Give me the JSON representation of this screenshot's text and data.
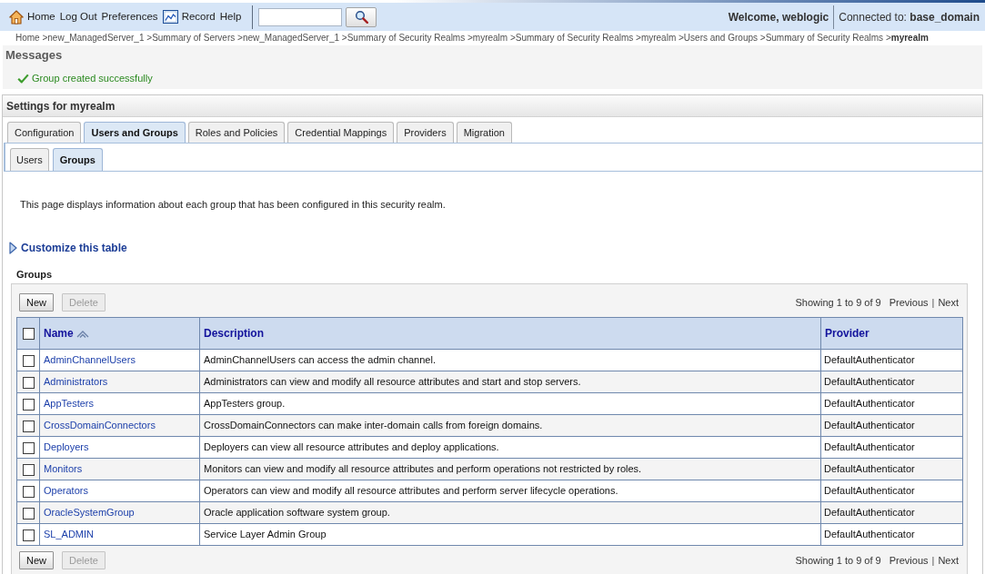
{
  "header": {
    "nav": [
      {
        "kind": "home",
        "label": "Home"
      },
      {
        "kind": "plain",
        "label": "Log Out"
      },
      {
        "kind": "plain",
        "label": "Preferences"
      },
      {
        "kind": "record",
        "label": "Record"
      },
      {
        "kind": "plain",
        "label": "Help"
      }
    ],
    "welcome": "Welcome, weblogic",
    "connection": "Connected to: **base_domain**"
  },
  "breadcrumb": {
    "separator": ">",
    "items": [
      {
        "label": "Home",
        "current": false
      },
      {
        "label": "new_ManagedServer_1",
        "current": false
      },
      {
        "label": "Summary of Servers",
        "current": false
      },
      {
        "label": "new_ManagedServer_1",
        "current": false
      },
      {
        "label": "Summary of Security Realms",
        "current": false
      },
      {
        "label": "myrealm",
        "current": false
      },
      {
        "label": "Summary of Security Realms",
        "current": false
      },
      {
        "label": "myrealm",
        "current": false
      },
      {
        "label": "Users and Groups",
        "current": false
      },
      {
        "label": "Summary of Security Realms",
        "current": false
      },
      {
        "label": "myrealm",
        "current": true
      }
    ]
  },
  "messages": {
    "title": "Messages",
    "items": [
      {
        "kind": "success",
        "text": "Group created successfully"
      }
    ]
  },
  "settings": {
    "title": "Settings for myrealm",
    "tabs": [
      {
        "label": "Configuration",
        "selected": false
      },
      {
        "label": "Users and Groups",
        "selected": true
      },
      {
        "label": "Roles and Policies",
        "selected": false
      },
      {
        "label": "Credential Mappings",
        "selected": false
      },
      {
        "label": "Providers",
        "selected": false
      },
      {
        "label": "Migration",
        "selected": false
      }
    ],
    "subtabs": [
      {
        "label": "Users",
        "selected": false
      },
      {
        "label": "Groups",
        "selected": true
      }
    ],
    "intro": "This page displays information about each group that has been configured in this security realm.",
    "customize": {
      "label": "Customize this table",
      "expanded": false
    },
    "groups": {
      "title": "Groups",
      "top_toolbar": {
        "buttons": [
          {
            "label": "New",
            "disabled": false
          },
          {
            "label": "Delete",
            "disabled": true
          }
        ],
        "pagination": {
          "summary": "Showing 1 to 9 of 9",
          "previous": {
            "label": "Previous",
            "disabled": true
          },
          "separator": "|",
          "next": {
            "label": "Next",
            "disabled": true
          }
        }
      },
      "columns": [
        {
          "kind": "select",
          "checked": false
        },
        {
          "kind": "label",
          "label": "Name",
          "sorted": true
        },
        {
          "kind": "label",
          "label": "Description",
          "sorted": false
        },
        {
          "kind": "label",
          "label": "Provider",
          "sorted": false
        }
      ],
      "rows": [
        {
          "checked": false,
          "name": "AdminChannelUsers",
          "description": "AdminChannelUsers can access the admin channel.",
          "provider": "DefaultAuthenticator"
        },
        {
          "checked": false,
          "name": "Administrators",
          "description": "Administrators can view and modify all resource attributes and start and stop servers.",
          "provider": "DefaultAuthenticator"
        },
        {
          "checked": false,
          "name": "AppTesters",
          "description": "AppTesters group.",
          "provider": "DefaultAuthenticator"
        },
        {
          "checked": false,
          "name": "CrossDomainConnectors",
          "description": "CrossDomainConnectors can make inter-domain calls from foreign domains.",
          "provider": "DefaultAuthenticator"
        },
        {
          "checked": false,
          "name": "Deployers",
          "description": "Deployers can view all resource attributes and deploy applications.",
          "provider": "DefaultAuthenticator"
        },
        {
          "checked": false,
          "name": "Monitors",
          "description": "Monitors can view and modify all resource attributes and perform operations not restricted by roles.",
          "provider": "DefaultAuthenticator"
        },
        {
          "checked": false,
          "name": "Operators",
          "description": "Operators can view and modify all resource attributes and perform server lifecycle operations.",
          "provider": "DefaultAuthenticator"
        },
        {
          "checked": false,
          "name": "OracleSystemGroup",
          "description": "Oracle application software system group.",
          "provider": "DefaultAuthenticator"
        },
        {
          "checked": false,
          "name": "SL_ADMIN",
          "description": "Service Layer Admin Group",
          "provider": "DefaultAuthenticator"
        }
      ],
      "bottom_toolbar": {
        "buttons": [
          {
            "label": "New",
            "disabled": false
          },
          {
            "label": "Delete",
            "disabled": true
          }
        ],
        "pagination": {
          "summary": "Showing 1 to 9 of 9",
          "previous": {
            "label": "Previous",
            "disabled": true
          },
          "separator": "|",
          "next": {
            "label": "Next",
            "disabled": true
          }
        }
      }
    }
  }
}
